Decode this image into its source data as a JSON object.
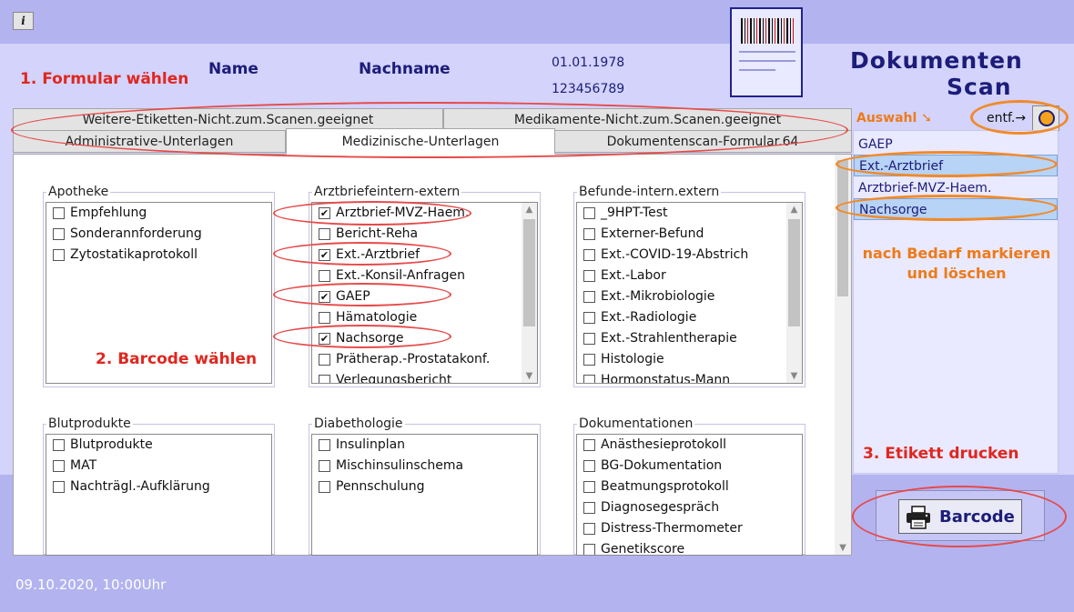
{
  "top": {
    "info_label": "i"
  },
  "annotations": {
    "step1": "1.  Formular wählen",
    "step2": "2.  Barcode wählen",
    "step3": "3.  Etikett drucken",
    "mark_delete_line1": "nach  Bedarf markieren",
    "mark_delete_line2": "und löschen"
  },
  "header": {
    "name": "Name",
    "nachname": "Nachname",
    "birthdate": "01.01.1978",
    "patient_id": "123456789",
    "title_line1": "Dokumenten",
    "title_line2": "Scan"
  },
  "tabs": {
    "row1": [
      "Weitere-Etiketten-Nicht.zum.Scanen.geeignet",
      "Medikamente-Nicht.zum.Scanen.geeignet"
    ],
    "row2": [
      "Administrative-Unterlagen",
      "Medizinische-Unterlagen",
      "Dokumentenscan-Formular.64"
    ],
    "active": "Medizinische-Unterlagen"
  },
  "groups": [
    {
      "title": "Apotheke",
      "items": [
        {
          "label": "Empfehlung",
          "checked": false
        },
        {
          "label": "Sonderannforderung",
          "checked": false
        },
        {
          "label": "Zytostatikaprotokoll",
          "checked": false
        }
      ]
    },
    {
      "title": "Arztbriefeintern-extern",
      "items": [
        {
          "label": "Arztbrief-MVZ-Haem.",
          "checked": true
        },
        {
          "label": "Bericht-Reha",
          "checked": false
        },
        {
          "label": "Ext.-Arztbrief",
          "checked": true
        },
        {
          "label": "Ext.-Konsil-Anfragen",
          "checked": false
        },
        {
          "label": "GAEP",
          "checked": true
        },
        {
          "label": "Hämatologie",
          "checked": false
        },
        {
          "label": "Nachsorge",
          "checked": true
        },
        {
          "label": "Prätherap.-Prostatakonf.",
          "checked": false
        },
        {
          "label": "Verlegungsbericht",
          "checked": false
        }
      ]
    },
    {
      "title": "Befunde-intern.extern",
      "items": [
        {
          "label": "_9HPT-Test",
          "checked": false
        },
        {
          "label": "Externer-Befund",
          "checked": false
        },
        {
          "label": "Ext.-COVID-19-Abstrich",
          "checked": false
        },
        {
          "label": "Ext.-Labor",
          "checked": false
        },
        {
          "label": "Ext.-Mikrobiologie",
          "checked": false
        },
        {
          "label": "Ext.-Radiologie",
          "checked": false
        },
        {
          "label": "Ext.-Strahlentherapie",
          "checked": false
        },
        {
          "label": "Histologie",
          "checked": false
        },
        {
          "label": "Hormonstatus-Mann",
          "checked": false
        }
      ]
    },
    {
      "title": "Blutprodukte",
      "items": [
        {
          "label": "Blutprodukte",
          "checked": false
        },
        {
          "label": "MAT",
          "checked": false
        },
        {
          "label": "Nachträgl.-Aufklärung",
          "checked": false
        }
      ]
    },
    {
      "title": "Diabethologie",
      "items": [
        {
          "label": "Insulinplan",
          "checked": false
        },
        {
          "label": "Mischinsulinschema",
          "checked": false
        },
        {
          "label": "Pennschulung",
          "checked": false
        }
      ]
    },
    {
      "title": "Dokumentationen",
      "items": [
        {
          "label": "Anästhesieprotokoll",
          "checked": false
        },
        {
          "label": "BG-Dokumentation",
          "checked": false
        },
        {
          "label": "Beatmungsprotokoll",
          "checked": false
        },
        {
          "label": "Diagnosegespräch",
          "checked": false
        },
        {
          "label": "Distress-Thermometer",
          "checked": false
        },
        {
          "label": "Genetikscore",
          "checked": false
        }
      ]
    }
  ],
  "selection": {
    "label": "Auswahl",
    "entf_label": "entf.→",
    "items": [
      {
        "label": "GAEP",
        "highlighted": false
      },
      {
        "label": "Ext.-Arztbrief",
        "highlighted": true
      },
      {
        "label": "Arztbrief-MVZ-Haem.",
        "highlighted": false
      },
      {
        "label": "Nachsorge",
        "highlighted": true
      }
    ]
  },
  "barcode_button": {
    "label": "Barcode"
  },
  "footer": {
    "timestamp": "09.10.2020, 10:00Uhr"
  },
  "colors": {
    "accent_red": "#e0271f",
    "accent_orange": "#ee7a18",
    "navy": "#1c1c7a"
  }
}
